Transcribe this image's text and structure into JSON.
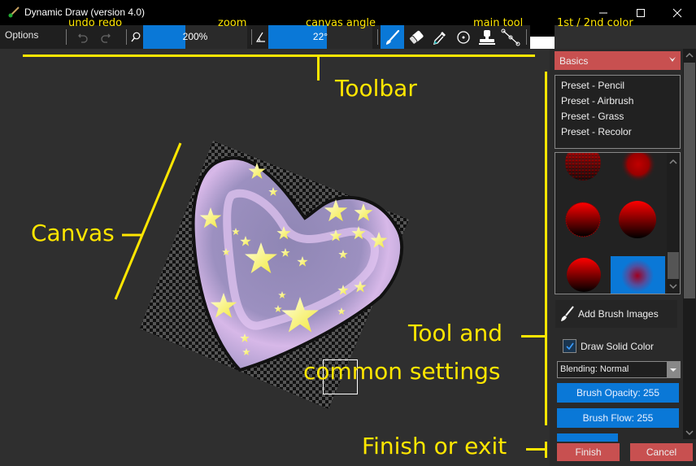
{
  "window": {
    "title": "Dynamic Draw (version 4.0)",
    "controls": [
      "minimize",
      "maximize",
      "close"
    ]
  },
  "toolbar": {
    "options_label": "Options",
    "undo_icon": "undo-icon",
    "redo_icon": "redo-icon",
    "zoom": {
      "icon": "magnifier-icon",
      "value_label": "200%",
      "fill_fraction": 0.41
    },
    "canvas_angle": {
      "icon": "angle-icon",
      "value_label": "22°",
      "fill_fraction": 0.56
    },
    "tools": [
      {
        "name": "brush",
        "icon": "brush-icon",
        "active": true
      },
      {
        "name": "eraser",
        "icon": "eraser-icon",
        "active": false
      },
      {
        "name": "color-picker",
        "icon": "eyedropper-icon",
        "active": false
      },
      {
        "name": "origin",
        "icon": "target-icon",
        "active": false
      },
      {
        "name": "clone-stamp",
        "icon": "stamp-icon",
        "active": false
      },
      {
        "name": "line-curve",
        "icon": "line-curve-icon",
        "active": false
      }
    ],
    "primary_color": "#ffffff",
    "secondary_color": "#000000"
  },
  "panel": {
    "preset_category": "Basics",
    "presets": [
      "Preset - Pencil",
      "Preset - Airbrush",
      "Preset - Grass",
      "Preset - Recolor"
    ],
    "brush_images": [
      "dotted-round",
      "soft-round",
      "rough-round",
      "hard-round",
      "hard-round-small",
      "soft-blur"
    ],
    "selected_brush_index": 5,
    "add_brush_images_label": "Add Brush Images",
    "draw_solid_color": {
      "label": "Draw Solid Color",
      "checked": true
    },
    "blending": "Blending: Normal",
    "brush_opacity_label": "Brush Opacity: 255",
    "brush_flow_label": "Brush Flow: 255",
    "finish_label": "Finish",
    "cancel_label": "Cancel"
  },
  "annotations": {
    "undo_redo": "undo redo",
    "zoom": "zoom",
    "canvas_angle": "canvas angle",
    "main_tool": "main tool",
    "colors": "1st / 2nd color",
    "toolbar": "Toolbar",
    "canvas": "Canvas",
    "tool_settings_line1": "Tool and",
    "tool_settings_line2": "common settings",
    "finish_exit": "Finish or exit"
  },
  "colors": {
    "accent_blue": "#0a78d7",
    "accent_red": "#c85050",
    "annotation_yellow": "#ffe600"
  }
}
